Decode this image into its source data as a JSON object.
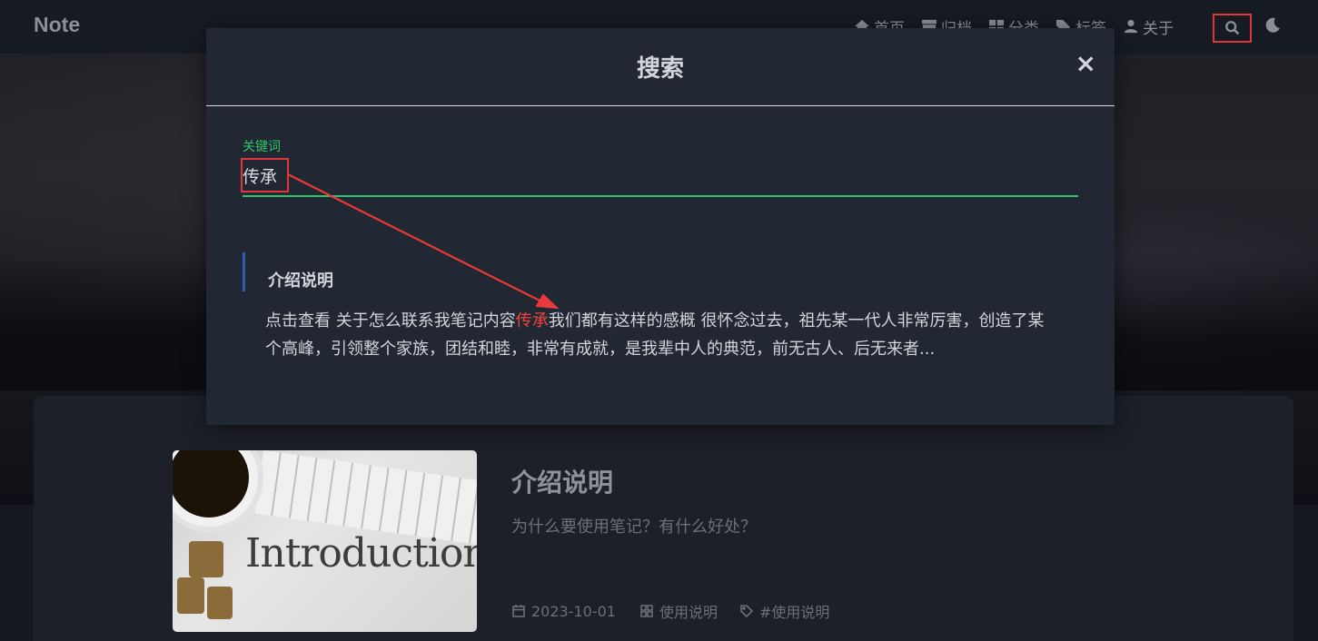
{
  "navbar": {
    "brand": "Note",
    "items": [
      {
        "label": "首页",
        "icon": "home-icon"
      },
      {
        "label": "归档",
        "icon": "archive-icon"
      },
      {
        "label": "分类",
        "icon": "category-icon"
      },
      {
        "label": "标签",
        "icon": "tags-icon"
      },
      {
        "label": "关于",
        "icon": "user-icon"
      }
    ],
    "search_icon": "search-icon",
    "theme_icon": "moon-icon"
  },
  "modal": {
    "title": "搜索",
    "close": "×",
    "field_label": "关键词",
    "query": "传承",
    "result": {
      "title": "介绍说明",
      "snippet_before": "点击查看 关于怎么联系我笔记内容",
      "snippet_match": "传承",
      "snippet_after": "我们都有这样的感概 很怀念过去，祖先某一代人非常厉害，创造了某个高峰，引领整个家族，团结和睦，非常有成就，是我辈中人的典范，前无古人、后无来者..."
    }
  },
  "post": {
    "thumbnail_text": "Introduction",
    "title": "介绍说明",
    "subtitle": "为什么要使用笔记？有什么好处？",
    "date": "2023-10-01",
    "category": "使用说明",
    "tag": "#使用说明"
  },
  "colors": {
    "accent_green": "#2ec769",
    "highlight_red": "#f0473f",
    "annotation_red": "#e0383a",
    "modal_bg": "#212733"
  }
}
